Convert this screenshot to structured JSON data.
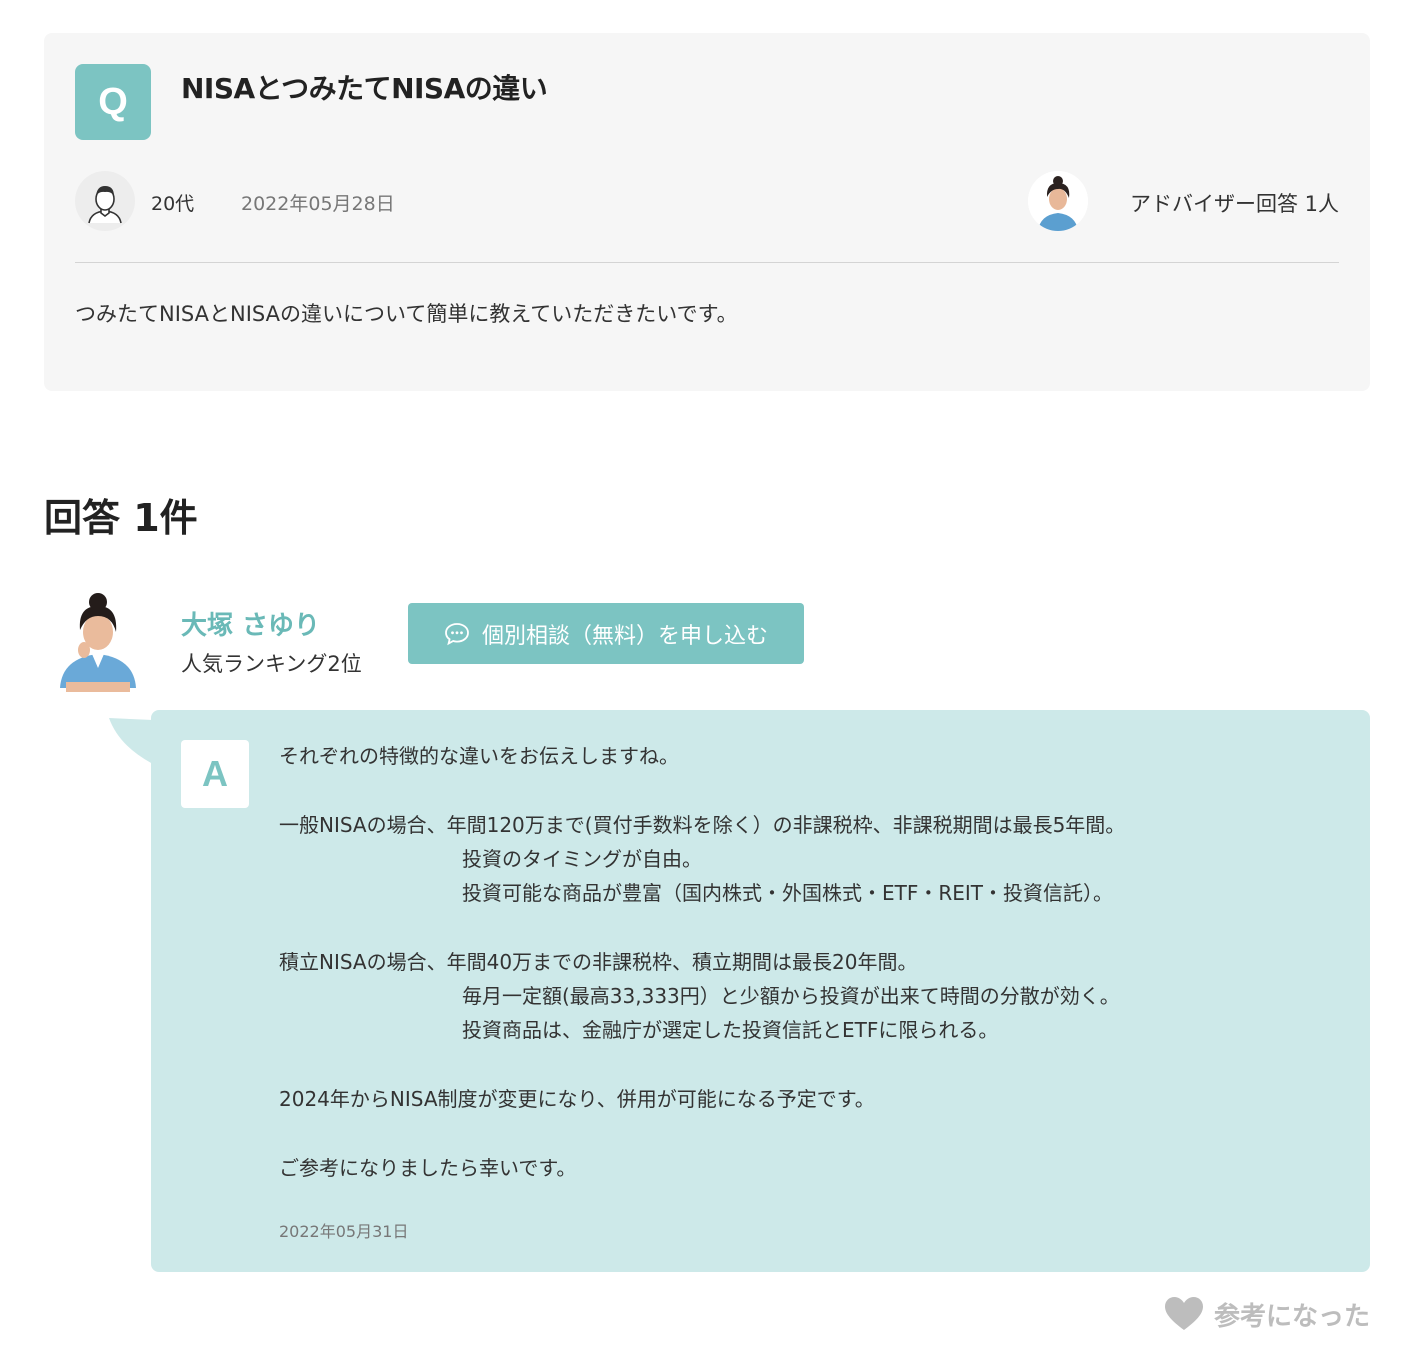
{
  "question": {
    "badge": "Q",
    "title": "NISAとつみたてNISAの違い",
    "asker_age": "20代",
    "date": "2022年05月28日",
    "advisor_answer_count": "アドバイザー回答 1人",
    "body": "つみたてNISAとNISAの違いについて簡単に教えていただきたいです。"
  },
  "answers": {
    "heading": "回答 1件",
    "items": [
      {
        "advisor_name": "大塚 さゆり",
        "rank": "人気ランキング2位",
        "consult_button": "個別相談（無料）を申し込む",
        "badge": "A",
        "lines": [
          "それぞれの特徴的な違いをお伝えしますね。",
          "",
          "一般NISAの場合、年間120万まで(買付手数料を除く）の非課税枠、非課税期間は最長5年間。",
          "投資のタイミングが自由。",
          "投資可能な商品が豊富（国内株式・外国株式・ETF・REIT・投資信託）。",
          "",
          "積立NISAの場合、年間40万までの非課税枠、積立期間は最長20年間。",
          "毎月一定額(最高33,333円）と少額から投資が出来て時間の分散が効く。",
          "投資商品は、金融庁が選定した投資信託とETFに限られる。",
          "",
          "2024年からNISA制度が変更になり、併用が可能になる予定です。",
          "",
          "ご参考になりましたら幸いです。"
        ],
        "date": "2022年05月31日",
        "helpful_label": "参考になった"
      }
    ]
  },
  "colors": {
    "accent": "#7cc4c2",
    "answer_bg": "#cde9e9",
    "question_bg": "#f6f6f6"
  }
}
